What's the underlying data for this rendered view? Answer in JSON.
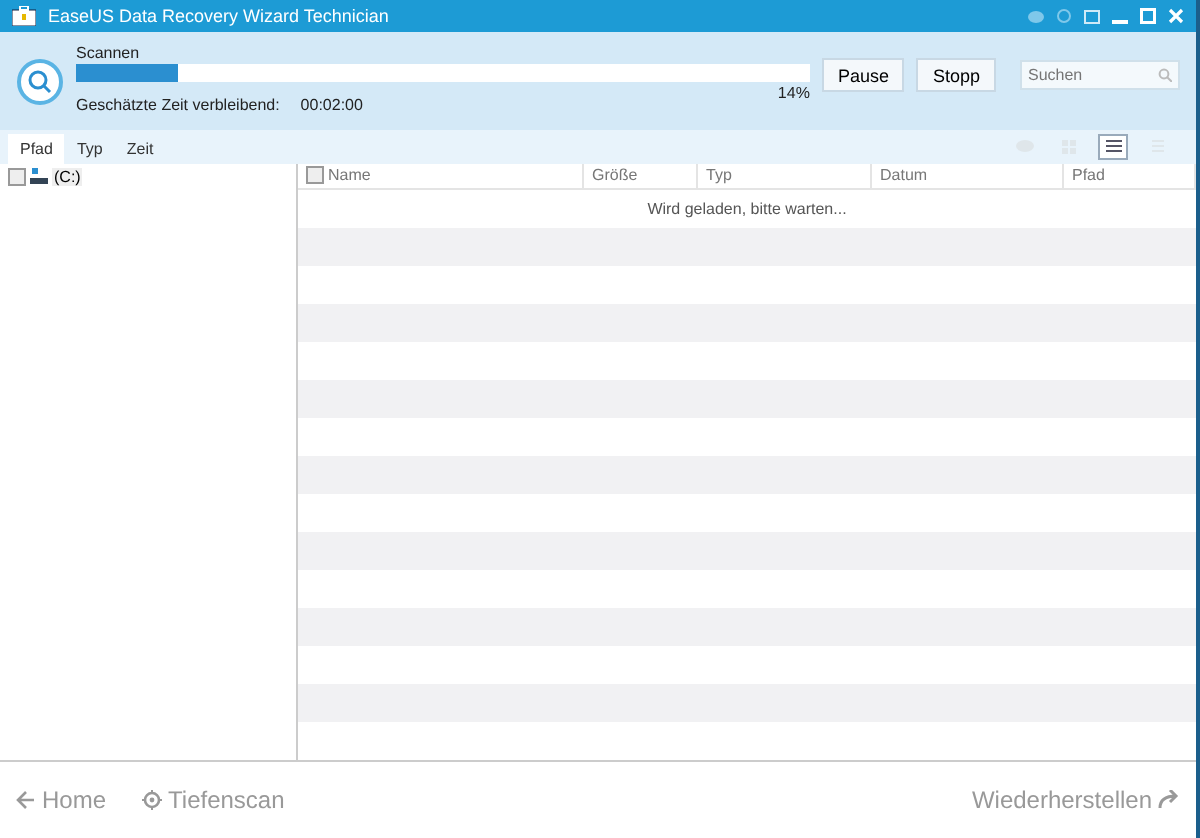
{
  "window": {
    "title": "EaseUS Data Recovery Wizard Technician"
  },
  "scan": {
    "label": "Scannen",
    "level": 0.14,
    "percent": "14%",
    "eta_label": "Geschätzte Zeit verbleibend:",
    "eta": "00:02:00"
  },
  "buttons": [
    "Pause",
    "Stopp"
  ],
  "search": {
    "placeholder": "Suchen"
  },
  "tabs": [
    {
      "label": "Pfad",
      "selected": true
    },
    {
      "label": "Typ",
      "selected": false
    },
    {
      "label": "Zeit",
      "selected": false
    }
  ],
  "views": [
    {
      "kind": "preview",
      "selected": false
    },
    {
      "kind": "grid",
      "selected": false
    },
    {
      "kind": "list",
      "selected": true
    },
    {
      "kind": "detail",
      "selected": false
    }
  ],
  "tree": [
    {
      "label": "(C:)",
      "checked": false
    }
  ],
  "table": {
    "columns": [
      "Name",
      "Größe",
      "Typ",
      "Datum",
      "Pfad"
    ],
    "all_checked": false,
    "message": "Wird geladen, bitte warten..."
  },
  "footer": {
    "home": "Home",
    "deep_scan": "Tiefenscan",
    "recover": "Wiederherstellen"
  }
}
